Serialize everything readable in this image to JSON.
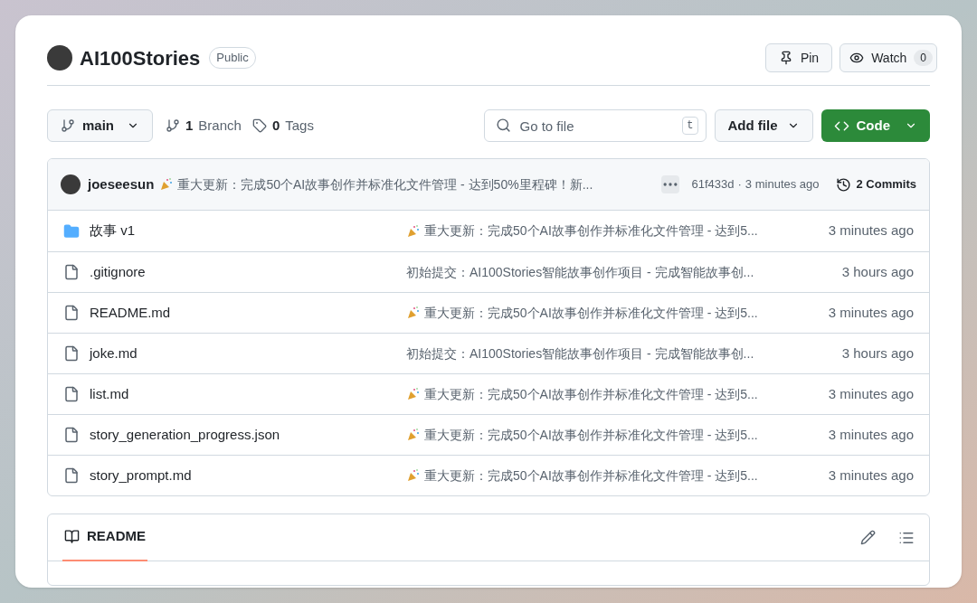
{
  "repo": {
    "name": "AI100Stories",
    "visibility": "Public"
  },
  "header_buttons": [
    {
      "kind": "pin",
      "label": "Pin"
    },
    {
      "kind": "watch",
      "label": "Watch",
      "count": "0"
    }
  ],
  "toolbar": {
    "branch": "main",
    "branches": {
      "count": "1",
      "label": "Branch"
    },
    "tags": {
      "count": "0",
      "label": "Tags"
    },
    "search": {
      "placeholder": "Go to file",
      "shortcut": "t"
    },
    "add_file": "Add file",
    "code": "Code"
  },
  "latest_commit": {
    "author": "joeseesun",
    "party_icon": true,
    "message": "重大更新：完成50个AI故事创作并标准化文件管理 - 达到50%里程碑！新...",
    "hash": "61f433d",
    "separator": "·",
    "time": "3 minutes ago",
    "commits": "2 Commits"
  },
  "files": [
    {
      "kind": "folder",
      "name": "故事 v1",
      "party_icon": true,
      "message": "重大更新：完成50个AI故事创作并标准化文件管理 - 达到5...",
      "time": "3 minutes ago"
    },
    {
      "kind": "file",
      "name": ".gitignore",
      "party_icon": false,
      "message": "初始提交：AI100Stories智能故事创作项目 - 完成智能故事创...",
      "time": "3 hours ago"
    },
    {
      "kind": "file",
      "name": "README.md",
      "party_icon": true,
      "message": "重大更新：完成50个AI故事创作并标准化文件管理 - 达到5...",
      "time": "3 minutes ago"
    },
    {
      "kind": "file",
      "name": "joke.md",
      "party_icon": false,
      "message": "初始提交：AI100Stories智能故事创作项目 - 完成智能故事创...",
      "time": "3 hours ago"
    },
    {
      "kind": "file",
      "name": "list.md",
      "party_icon": true,
      "message": "重大更新：完成50个AI故事创作并标准化文件管理 - 达到5...",
      "time": "3 minutes ago"
    },
    {
      "kind": "file",
      "name": "story_generation_progress.json",
      "party_icon": true,
      "message": "重大更新：完成50个AI故事创作并标准化文件管理 - 达到5...",
      "time": "3 minutes ago"
    },
    {
      "kind": "file",
      "name": "story_prompt.md",
      "party_icon": true,
      "message": "重大更新：完成50个AI故事创作并标准化文件管理 - 达到5...",
      "time": "3 minutes ago"
    }
  ],
  "readme": {
    "title": "README"
  }
}
